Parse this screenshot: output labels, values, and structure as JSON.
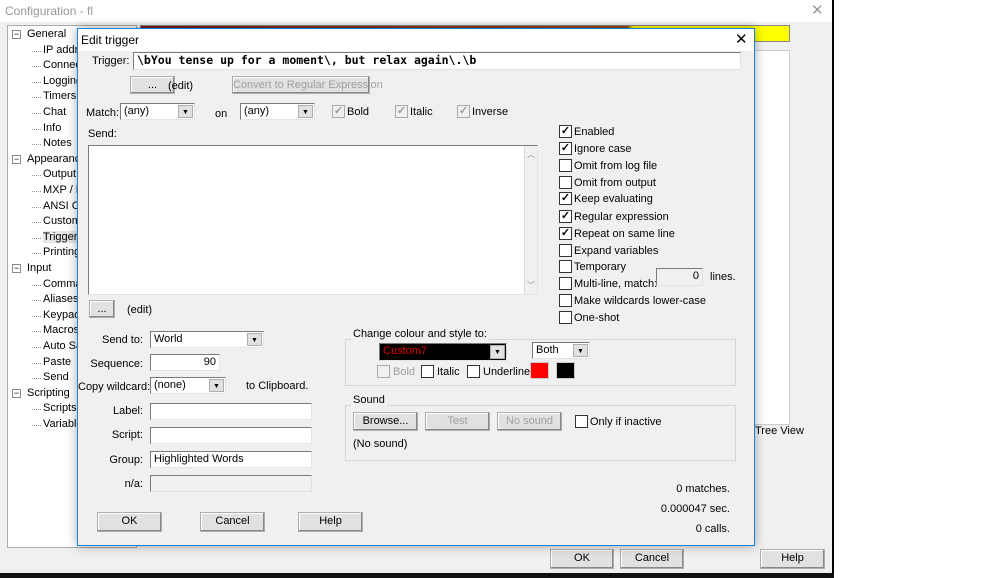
{
  "window": {
    "title": "Configuration - fl",
    "ok": "OK",
    "cancel": "Cancel",
    "help": "Help",
    "tree_view_label": "Tree View"
  },
  "tree": [
    {
      "label": "General",
      "level": 0,
      "expanded": true
    },
    {
      "label": "IP addr",
      "level": 1
    },
    {
      "label": "Connec",
      "level": 1
    },
    {
      "label": "Logging",
      "level": 1
    },
    {
      "label": "Timers",
      "level": 1
    },
    {
      "label": "Chat",
      "level": 1
    },
    {
      "label": "Info",
      "level": 1
    },
    {
      "label": "Notes",
      "level": 1
    },
    {
      "label": "Appearanc",
      "level": 0,
      "expanded": true
    },
    {
      "label": "Output",
      "level": 1
    },
    {
      "label": "MXP / P",
      "level": 1
    },
    {
      "label": "ANSI C",
      "level": 1
    },
    {
      "label": "Custom",
      "level": 1
    },
    {
      "label": "Trigger",
      "level": 1,
      "selected": true
    },
    {
      "label": "Printing",
      "level": 1
    },
    {
      "label": "Input",
      "level": 0,
      "expanded": true
    },
    {
      "label": "Comma",
      "level": 1
    },
    {
      "label": "Aliases",
      "level": 1
    },
    {
      "label": "Keypad",
      "level": 1
    },
    {
      "label": "Macros",
      "level": 1
    },
    {
      "label": "Auto Sa",
      "level": 1
    },
    {
      "label": "Paste",
      "level": 1
    },
    {
      "label": "Send",
      "level": 1
    },
    {
      "label": "Scripting",
      "level": 0,
      "expanded": true
    },
    {
      "label": "Scripts",
      "level": 1
    },
    {
      "label": "Variable",
      "level": 1
    }
  ],
  "dialog": {
    "title": "Edit trigger",
    "trigger_label": "Trigger:",
    "trigger_value": "\\bYou tense up for a moment\\, but relax again\\.\\b",
    "ellipsis": "...",
    "edit": "(edit)",
    "convert_button": "Convert to Regular Expression",
    "match_label": "Match:",
    "match_value": "(any)",
    "on_label": "on",
    "on_value": "(any)",
    "bold": "Bold",
    "italic": "Italic",
    "inverse": "Inverse",
    "send_label": "Send:",
    "send_value": "",
    "send_to_label": "Send to:",
    "send_to_value": "World",
    "sequence_label": "Sequence:",
    "sequence_value": "90",
    "copy_wildcard_label": "Copy wildcard:",
    "copy_wildcard_value": "(none)",
    "to_clipboard": "to Clipboard.",
    "label_label": "Label:",
    "label_value": "",
    "script_label": "Script:",
    "script_value": "",
    "group_label": "Group:",
    "group_value": "Highlighted Words",
    "na_label": "n/a:",
    "na_value": "",
    "options": [
      {
        "label": "Enabled",
        "checked": true
      },
      {
        "label": "Ignore case",
        "checked": true
      },
      {
        "label": "Omit from log file",
        "checked": false
      },
      {
        "label": "Omit from output",
        "checked": false
      },
      {
        "label": "Keep evaluating",
        "checked": true
      },
      {
        "label": "Regular expression",
        "checked": true
      },
      {
        "label": "Repeat on same line",
        "checked": true
      },
      {
        "label": "Expand variables",
        "checked": false
      },
      {
        "label": "Temporary",
        "checked": false
      },
      {
        "label": "Multi-line, match:",
        "checked": false
      },
      {
        "label": "Make wildcards lower-case",
        "checked": false
      },
      {
        "label": "One-shot",
        "checked": false
      }
    ],
    "multiline_lines": "0",
    "lines_label": "lines.",
    "colour": {
      "group_title": "Change colour and style to:",
      "colour_value": "Custom7",
      "apply_value": "Both",
      "bold": "Bold",
      "italic": "Italic",
      "underline": "Underline",
      "fg": "#ff0000",
      "bg": "#000000"
    },
    "sound": {
      "group_title": "Sound",
      "browse": "Browse...",
      "test": "Test",
      "no_sound_button": "No sound",
      "only_if_inactive": "Only if inactive",
      "status": "(No sound)"
    },
    "stats": {
      "matches": "0 matches.",
      "time": "0.000047 sec.",
      "calls": "0 calls."
    },
    "ok": "OK",
    "cancel": "Cancel",
    "help": "Help"
  }
}
